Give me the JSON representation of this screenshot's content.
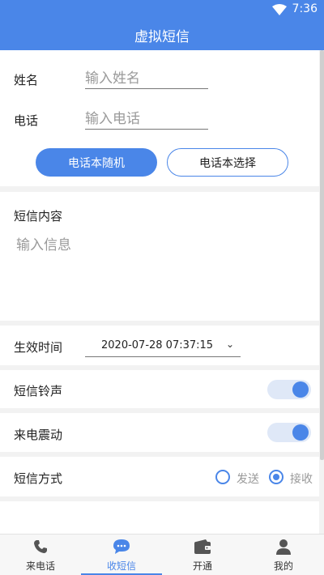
{
  "status": {
    "time": "7:36"
  },
  "appbar": {
    "title": "虚拟短信"
  },
  "form": {
    "name_label": "姓名",
    "name_placeholder": "输入姓名",
    "phone_label": "电话",
    "phone_placeholder": "输入电话",
    "random_button": "电话本随机",
    "choose_button": "电话本选择"
  },
  "message": {
    "title": "短信内容",
    "placeholder": "输入信息"
  },
  "settings": {
    "effect_time_label": "生效时间",
    "effect_time_value": "2020-07-28 07:37:15",
    "ringtone_label": "短信铃声",
    "ringtone_on": true,
    "vibrate_label": "来电震动",
    "vibrate_on": true,
    "mode_label": "短信方式",
    "mode_send": "发送",
    "mode_receive": "接收",
    "mode_selected": "接收"
  },
  "nav": {
    "items": [
      {
        "label": "来电话",
        "icon": "phone-icon"
      },
      {
        "label": "收短信",
        "icon": "chat-icon"
      },
      {
        "label": "开通",
        "icon": "wallet-icon"
      },
      {
        "label": "我的",
        "icon": "person-icon"
      }
    ],
    "active_index": 1
  },
  "colors": {
    "accent": "#4a86e8",
    "background": "#f2f2f2"
  }
}
